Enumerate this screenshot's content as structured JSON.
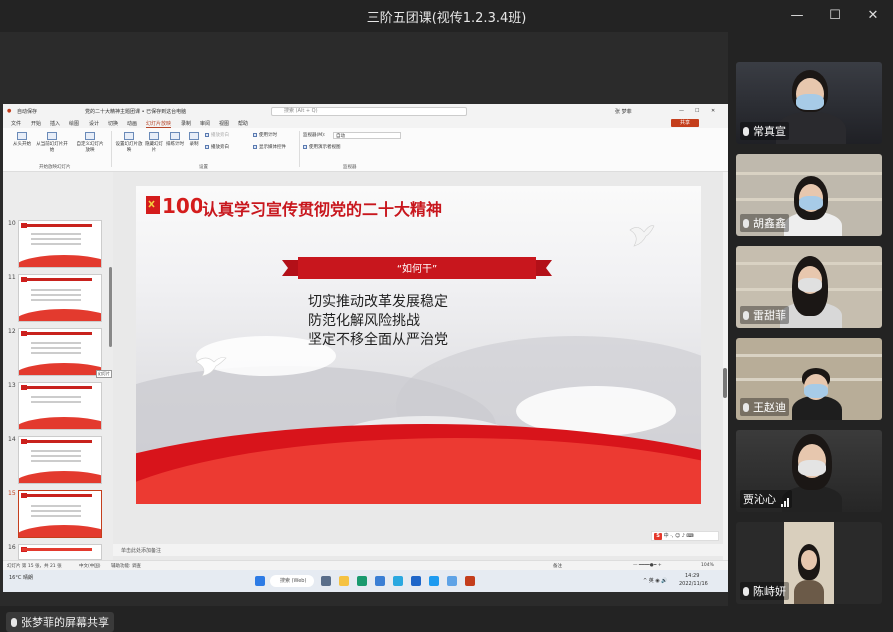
{
  "window": {
    "title": "三阶五团课(视传1.2.3.4班)",
    "minimize": "—",
    "maximize": "☐",
    "close": "✕"
  },
  "ppt": {
    "autosave": "自动保存",
    "doc_title": "党的二十大精神主题团课 • 已保存到这台电脑",
    "search_placeholder": "搜索 (Alt + Q)",
    "user": "张 梦菲",
    "menu": [
      "文件",
      "开始",
      "插入",
      "绘图",
      "设计",
      "切换",
      "动画",
      "幻灯片放映",
      "录制",
      "审阅",
      "视图",
      "帮助"
    ],
    "active_menu": "幻灯片放映",
    "share": "共享",
    "ribbon": {
      "from_start": "从头开始",
      "from_current": "从当前幻灯片开始",
      "custom": "自定义幻灯片放映",
      "setup": "设置幻灯片放映",
      "hide": "隐藏幻灯片",
      "rehearse": "排练计时",
      "record": "录制",
      "group_start": "开始放映幻灯片",
      "group_setup": "设置",
      "group_monitor": "监视器",
      "chk_narration": "播放旁白",
      "chk_timing": "使用计时",
      "chk_media": "显示媒体控件",
      "chk_play": "播放旁白",
      "monitor_label": "监视器(M):",
      "monitor_value": "自动",
      "presenter_view": "使用演示者视图"
    },
    "thumbnails": [
      {
        "num": "10"
      },
      {
        "num": "11"
      },
      {
        "num": "12"
      },
      {
        "num": "13"
      },
      {
        "num": "14"
      },
      {
        "num": "15"
      },
      {
        "num": "16"
      }
    ],
    "tooltip": "幻灯片",
    "slide": {
      "title": "认真学习宣传贯彻党的二十大精神",
      "banner": "“如何干”",
      "bullets": [
        "切实推动改革发展稳定",
        "防范化解风险挑战",
        "坚定不移全面从严治党"
      ]
    },
    "notes_placeholder": "单击此处添加备注",
    "status": {
      "slide_info": "幻灯片 第 15 张，共 21 张",
      "language": "中文(中国)",
      "accessibility": "辅助功能: 调查",
      "notes": "备注",
      "zoom": "104%"
    },
    "ime": "中",
    "taskbar": {
      "weather": "16°C 晴朗",
      "search": "搜索 (Web)",
      "time": "14:29",
      "date": "2022/11/16"
    }
  },
  "participants": [
    {
      "name": "常真宣",
      "muted": true
    },
    {
      "name": "胡鑫鑫",
      "muted": true
    },
    {
      "name": "雷甜菲",
      "muted": true
    },
    {
      "name": "王赵迪",
      "muted": true
    },
    {
      "name": "贾沁心",
      "muted": false
    },
    {
      "name": "陈峙妍",
      "muted": true
    }
  ],
  "share_note": "张梦菲的屏幕共享",
  "colors": {
    "accent_red": "#c8161d",
    "ppt_accent": "#b7472a"
  }
}
